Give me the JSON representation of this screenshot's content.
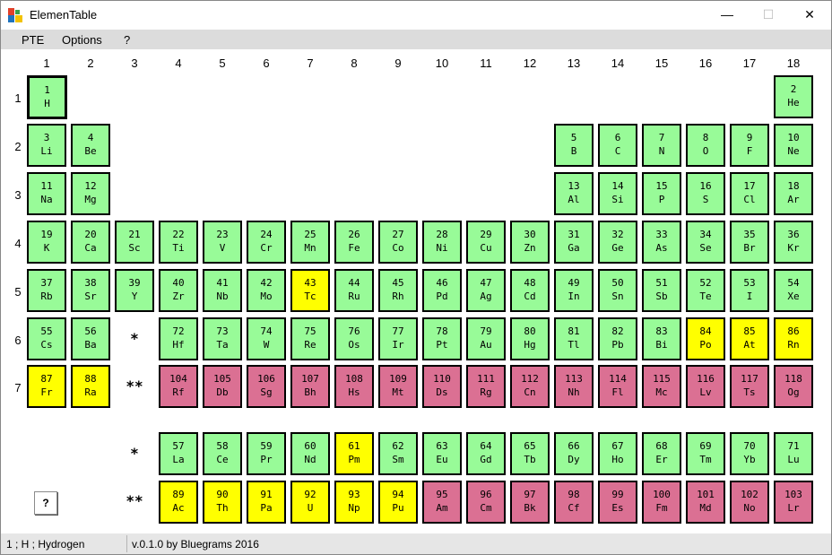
{
  "window": {
    "title": "ElemenTable",
    "min_glyph": "—",
    "max_glyph": "☐",
    "close_glyph": "✕"
  },
  "menu": [
    "PTE",
    "Options",
    "?"
  ],
  "group_numbers": [
    "1",
    "2",
    "3",
    "4",
    "5",
    "6",
    "7",
    "8",
    "9",
    "10",
    "11",
    "12",
    "13",
    "14",
    "15",
    "16",
    "17",
    "18"
  ],
  "period_numbers": [
    "1",
    "2",
    "3",
    "4",
    "5",
    "6",
    "7"
  ],
  "markers": {
    "lanthanide": "*",
    "actinide": "**"
  },
  "colors": {
    "default": "#98fb98",
    "radioactive": "#ffff00",
    "synthetic": "#db7093"
  },
  "selected_element": "H",
  "elements": [
    {
      "n": "1",
      "s": "H",
      "g": 1,
      "p": 1,
      "c": "green"
    },
    {
      "n": "2",
      "s": "He",
      "g": 18,
      "p": 1,
      "c": "green"
    },
    {
      "n": "3",
      "s": "Li",
      "g": 1,
      "p": 2,
      "c": "green"
    },
    {
      "n": "4",
      "s": "Be",
      "g": 2,
      "p": 2,
      "c": "green"
    },
    {
      "n": "5",
      "s": "B",
      "g": 13,
      "p": 2,
      "c": "green"
    },
    {
      "n": "6",
      "s": "C",
      "g": 14,
      "p": 2,
      "c": "green"
    },
    {
      "n": "7",
      "s": "N",
      "g": 15,
      "p": 2,
      "c": "green"
    },
    {
      "n": "8",
      "s": "O",
      "g": 16,
      "p": 2,
      "c": "green"
    },
    {
      "n": "9",
      "s": "F",
      "g": 17,
      "p": 2,
      "c": "green"
    },
    {
      "n": "10",
      "s": "Ne",
      "g": 18,
      "p": 2,
      "c": "green"
    },
    {
      "n": "11",
      "s": "Na",
      "g": 1,
      "p": 3,
      "c": "green"
    },
    {
      "n": "12",
      "s": "Mg",
      "g": 2,
      "p": 3,
      "c": "green"
    },
    {
      "n": "13",
      "s": "Al",
      "g": 13,
      "p": 3,
      "c": "green"
    },
    {
      "n": "14",
      "s": "Si",
      "g": 14,
      "p": 3,
      "c": "green"
    },
    {
      "n": "15",
      "s": "P",
      "g": 15,
      "p": 3,
      "c": "green"
    },
    {
      "n": "16",
      "s": "S",
      "g": 16,
      "p": 3,
      "c": "green"
    },
    {
      "n": "17",
      "s": "Cl",
      "g": 17,
      "p": 3,
      "c": "green"
    },
    {
      "n": "18",
      "s": "Ar",
      "g": 18,
      "p": 3,
      "c": "green"
    },
    {
      "n": "19",
      "s": "K",
      "g": 1,
      "p": 4,
      "c": "green"
    },
    {
      "n": "20",
      "s": "Ca",
      "g": 2,
      "p": 4,
      "c": "green"
    },
    {
      "n": "21",
      "s": "Sc",
      "g": 3,
      "p": 4,
      "c": "green"
    },
    {
      "n": "22",
      "s": "Ti",
      "g": 4,
      "p": 4,
      "c": "green"
    },
    {
      "n": "23",
      "s": "V",
      "g": 5,
      "p": 4,
      "c": "green"
    },
    {
      "n": "24",
      "s": "Cr",
      "g": 6,
      "p": 4,
      "c": "green"
    },
    {
      "n": "25",
      "s": "Mn",
      "g": 7,
      "p": 4,
      "c": "green"
    },
    {
      "n": "26",
      "s": "Fe",
      "g": 8,
      "p": 4,
      "c": "green"
    },
    {
      "n": "27",
      "s": "Co",
      "g": 9,
      "p": 4,
      "c": "green"
    },
    {
      "n": "28",
      "s": "Ni",
      "g": 10,
      "p": 4,
      "c": "green"
    },
    {
      "n": "29",
      "s": "Cu",
      "g": 11,
      "p": 4,
      "c": "green"
    },
    {
      "n": "30",
      "s": "Zn",
      "g": 12,
      "p": 4,
      "c": "green"
    },
    {
      "n": "31",
      "s": "Ga",
      "g": 13,
      "p": 4,
      "c": "green"
    },
    {
      "n": "32",
      "s": "Ge",
      "g": 14,
      "p": 4,
      "c": "green"
    },
    {
      "n": "33",
      "s": "As",
      "g": 15,
      "p": 4,
      "c": "green"
    },
    {
      "n": "34",
      "s": "Se",
      "g": 16,
      "p": 4,
      "c": "green"
    },
    {
      "n": "35",
      "s": "Br",
      "g": 17,
      "p": 4,
      "c": "green"
    },
    {
      "n": "36",
      "s": "Kr",
      "g": 18,
      "p": 4,
      "c": "green"
    },
    {
      "n": "37",
      "s": "Rb",
      "g": 1,
      "p": 5,
      "c": "green"
    },
    {
      "n": "38",
      "s": "Sr",
      "g": 2,
      "p": 5,
      "c": "green"
    },
    {
      "n": "39",
      "s": "Y",
      "g": 3,
      "p": 5,
      "c": "green"
    },
    {
      "n": "40",
      "s": "Zr",
      "g": 4,
      "p": 5,
      "c": "green"
    },
    {
      "n": "41",
      "s": "Nb",
      "g": 5,
      "p": 5,
      "c": "green"
    },
    {
      "n": "42",
      "s": "Mo",
      "g": 6,
      "p": 5,
      "c": "green"
    },
    {
      "n": "43",
      "s": "Tc",
      "g": 7,
      "p": 5,
      "c": "yellow"
    },
    {
      "n": "44",
      "s": "Ru",
      "g": 8,
      "p": 5,
      "c": "green"
    },
    {
      "n": "45",
      "s": "Rh",
      "g": 9,
      "p": 5,
      "c": "green"
    },
    {
      "n": "46",
      "s": "Pd",
      "g": 10,
      "p": 5,
      "c": "green"
    },
    {
      "n": "47",
      "s": "Ag",
      "g": 11,
      "p": 5,
      "c": "green"
    },
    {
      "n": "48",
      "s": "Cd",
      "g": 12,
      "p": 5,
      "c": "green"
    },
    {
      "n": "49",
      "s": "In",
      "g": 13,
      "p": 5,
      "c": "green"
    },
    {
      "n": "50",
      "s": "Sn",
      "g": 14,
      "p": 5,
      "c": "green"
    },
    {
      "n": "51",
      "s": "Sb",
      "g": 15,
      "p": 5,
      "c": "green"
    },
    {
      "n": "52",
      "s": "Te",
      "g": 16,
      "p": 5,
      "c": "green"
    },
    {
      "n": "53",
      "s": "I",
      "g": 17,
      "p": 5,
      "c": "green"
    },
    {
      "n": "54",
      "s": "Xe",
      "g": 18,
      "p": 5,
      "c": "green"
    },
    {
      "n": "55",
      "s": "Cs",
      "g": 1,
      "p": 6,
      "c": "green"
    },
    {
      "n": "56",
      "s": "Ba",
      "g": 2,
      "p": 6,
      "c": "green"
    },
    {
      "n": "72",
      "s": "Hf",
      "g": 4,
      "p": 6,
      "c": "green"
    },
    {
      "n": "73",
      "s": "Ta",
      "g": 5,
      "p": 6,
      "c": "green"
    },
    {
      "n": "74",
      "s": "W",
      "g": 6,
      "p": 6,
      "c": "green"
    },
    {
      "n": "75",
      "s": "Re",
      "g": 7,
      "p": 6,
      "c": "green"
    },
    {
      "n": "76",
      "s": "Os",
      "g": 8,
      "p": 6,
      "c": "green"
    },
    {
      "n": "77",
      "s": "Ir",
      "g": 9,
      "p": 6,
      "c": "green"
    },
    {
      "n": "78",
      "s": "Pt",
      "g": 10,
      "p": 6,
      "c": "green"
    },
    {
      "n": "79",
      "s": "Au",
      "g": 11,
      "p": 6,
      "c": "green"
    },
    {
      "n": "80",
      "s": "Hg",
      "g": 12,
      "p": 6,
      "c": "green"
    },
    {
      "n": "81",
      "s": "Tl",
      "g": 13,
      "p": 6,
      "c": "green"
    },
    {
      "n": "82",
      "s": "Pb",
      "g": 14,
      "p": 6,
      "c": "green"
    },
    {
      "n": "83",
      "s": "Bi",
      "g": 15,
      "p": 6,
      "c": "green"
    },
    {
      "n": "84",
      "s": "Po",
      "g": 16,
      "p": 6,
      "c": "yellow"
    },
    {
      "n": "85",
      "s": "At",
      "g": 17,
      "p": 6,
      "c": "yellow"
    },
    {
      "n": "86",
      "s": "Rn",
      "g": 18,
      "p": 6,
      "c": "yellow"
    },
    {
      "n": "87",
      "s": "Fr",
      "g": 1,
      "p": 7,
      "c": "yellow"
    },
    {
      "n": "88",
      "s": "Ra",
      "g": 2,
      "p": 7,
      "c": "yellow"
    },
    {
      "n": "104",
      "s": "Rf",
      "g": 4,
      "p": 7,
      "c": "pink"
    },
    {
      "n": "105",
      "s": "Db",
      "g": 5,
      "p": 7,
      "c": "pink"
    },
    {
      "n": "106",
      "s": "Sg",
      "g": 6,
      "p": 7,
      "c": "pink"
    },
    {
      "n": "107",
      "s": "Bh",
      "g": 7,
      "p": 7,
      "c": "pink"
    },
    {
      "n": "108",
      "s": "Hs",
      "g": 8,
      "p": 7,
      "c": "pink"
    },
    {
      "n": "109",
      "s": "Mt",
      "g": 9,
      "p": 7,
      "c": "pink"
    },
    {
      "n": "110",
      "s": "Ds",
      "g": 10,
      "p": 7,
      "c": "pink"
    },
    {
      "n": "111",
      "s": "Rg",
      "g": 11,
      "p": 7,
      "c": "pink"
    },
    {
      "n": "112",
      "s": "Cn",
      "g": 12,
      "p": 7,
      "c": "pink"
    },
    {
      "n": "113",
      "s": "Nh",
      "g": 13,
      "p": 7,
      "c": "pink"
    },
    {
      "n": "114",
      "s": "Fl",
      "g": 14,
      "p": 7,
      "c": "pink"
    },
    {
      "n": "115",
      "s": "Mc",
      "g": 15,
      "p": 7,
      "c": "pink"
    },
    {
      "n": "116",
      "s": "Lv",
      "g": 16,
      "p": 7,
      "c": "pink"
    },
    {
      "n": "117",
      "s": "Ts",
      "g": 17,
      "p": 7,
      "c": "pink"
    },
    {
      "n": "118",
      "s": "Og",
      "g": 18,
      "p": 7,
      "c": "pink"
    },
    {
      "n": "57",
      "s": "La",
      "g": 4,
      "p": 8,
      "c": "green"
    },
    {
      "n": "58",
      "s": "Ce",
      "g": 5,
      "p": 8,
      "c": "green"
    },
    {
      "n": "59",
      "s": "Pr",
      "g": 6,
      "p": 8,
      "c": "green"
    },
    {
      "n": "60",
      "s": "Nd",
      "g": 7,
      "p": 8,
      "c": "green"
    },
    {
      "n": "61",
      "s": "Pm",
      "g": 8,
      "p": 8,
      "c": "yellow"
    },
    {
      "n": "62",
      "s": "Sm",
      "g": 9,
      "p": 8,
      "c": "green"
    },
    {
      "n": "63",
      "s": "Eu",
      "g": 10,
      "p": 8,
      "c": "green"
    },
    {
      "n": "64",
      "s": "Gd",
      "g": 11,
      "p": 8,
      "c": "green"
    },
    {
      "n": "65",
      "s": "Tb",
      "g": 12,
      "p": 8,
      "c": "green"
    },
    {
      "n": "66",
      "s": "Dy",
      "g": 13,
      "p": 8,
      "c": "green"
    },
    {
      "n": "67",
      "s": "Ho",
      "g": 14,
      "p": 8,
      "c": "green"
    },
    {
      "n": "68",
      "s": "Er",
      "g": 15,
      "p": 8,
      "c": "green"
    },
    {
      "n": "69",
      "s": "Tm",
      "g": 16,
      "p": 8,
      "c": "green"
    },
    {
      "n": "70",
      "s": "Yb",
      "g": 17,
      "p": 8,
      "c": "green"
    },
    {
      "n": "71",
      "s": "Lu",
      "g": 18,
      "p": 8,
      "c": "green"
    },
    {
      "n": "89",
      "s": "Ac",
      "g": 4,
      "p": 9,
      "c": "yellow"
    },
    {
      "n": "90",
      "s": "Th",
      "g": 5,
      "p": 9,
      "c": "yellow"
    },
    {
      "n": "91",
      "s": "Pa",
      "g": 6,
      "p": 9,
      "c": "yellow"
    },
    {
      "n": "92",
      "s": "U",
      "g": 7,
      "p": 9,
      "c": "yellow"
    },
    {
      "n": "93",
      "s": "Np",
      "g": 8,
      "p": 9,
      "c": "yellow"
    },
    {
      "n": "94",
      "s": "Pu",
      "g": 9,
      "p": 9,
      "c": "yellow"
    },
    {
      "n": "95",
      "s": "Am",
      "g": 10,
      "p": 9,
      "c": "pink"
    },
    {
      "n": "96",
      "s": "Cm",
      "g": 11,
      "p": 9,
      "c": "pink"
    },
    {
      "n": "97",
      "s": "Bk",
      "g": 12,
      "p": 9,
      "c": "pink"
    },
    {
      "n": "98",
      "s": "Cf",
      "g": 13,
      "p": 9,
      "c": "pink"
    },
    {
      "n": "99",
      "s": "Es",
      "g": 14,
      "p": 9,
      "c": "pink"
    },
    {
      "n": "100",
      "s": "Fm",
      "g": 15,
      "p": 9,
      "c": "pink"
    },
    {
      "n": "101",
      "s": "Md",
      "g": 16,
      "p": 9,
      "c": "pink"
    },
    {
      "n": "102",
      "s": "No",
      "g": 17,
      "p": 9,
      "c": "pink"
    },
    {
      "n": "103",
      "s": "Lr",
      "g": 18,
      "p": 9,
      "c": "pink"
    }
  ],
  "help_button": "?",
  "status": {
    "left": "1 ; H ; Hydrogen",
    "right": "v.0.1.0 by Bluegrams 2016"
  }
}
